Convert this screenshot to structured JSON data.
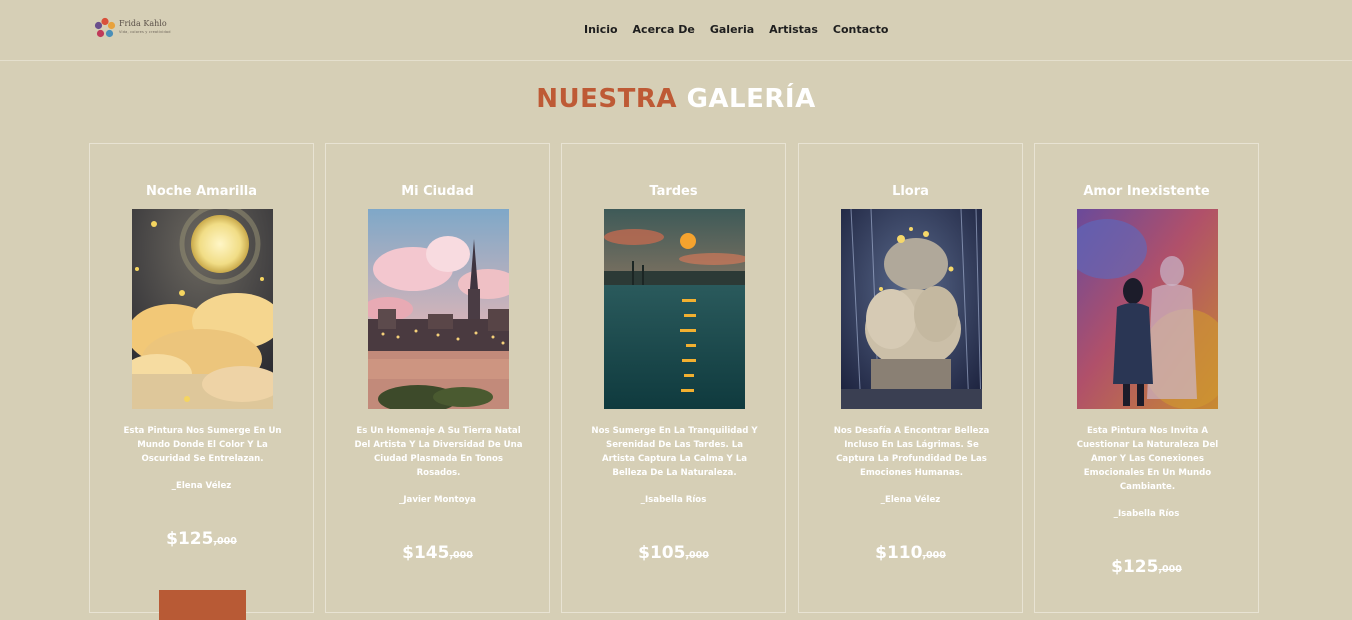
{
  "brand": {
    "name": "Frida Kahlo",
    "tagline": "Vida, colores y creatividad"
  },
  "nav": {
    "items": [
      "Inicio",
      "Acerca De",
      "Galeria",
      "Artistas",
      "Contacto"
    ]
  },
  "gallery": {
    "title_part1": "NUESTRA",
    "title_part2": "GALERÍA",
    "cards": [
      {
        "title": "Noche Amarilla",
        "description": "Esta Pintura Nos Sumerge En Un Mundo Donde El Color Y La Oscuridad Se Entrelazan.",
        "artist": "_Elena Vélez",
        "price": "$125",
        "cents": ",000"
      },
      {
        "title": "Mi Ciudad",
        "description": "Es Un Homenaje A Su Tierra Natal Del Artista Y La Diversidad De Una Ciudad Plasmada En Tonos Rosados.",
        "artist": "_Javier Montoya",
        "price": "$145",
        "cents": ",000"
      },
      {
        "title": "Tardes",
        "description": "Nos Sumerge En La Tranquilidad Y Serenidad De Las Tardes. La Artista Captura La Calma Y La Belleza De La Naturaleza.",
        "artist": "_Isabella Ríos",
        "price": "$105",
        "cents": ",000"
      },
      {
        "title": "Llora",
        "description": "Nos Desafía A Encontrar Belleza Incluso En Las Lágrimas. Se Captura La Profundidad De Las Emociones Humanas.",
        "artist": "_Elena Vélez",
        "price": "$110",
        "cents": ",000"
      },
      {
        "title": "Amor Inexistente",
        "description": "Esta Pintura Nos Invita A Cuestionar La Naturaleza Del Amor Y Las Conexiones Emocionales En Un Mundo Cambiante.",
        "artist": "_Isabella Ríos",
        "price": "$125",
        "cents": ",000"
      }
    ]
  },
  "colors": {
    "background": "#d6cfb6",
    "accent": "#be5a35",
    "text_light": "#ffffff",
    "nav_text": "#1e1e1e"
  }
}
